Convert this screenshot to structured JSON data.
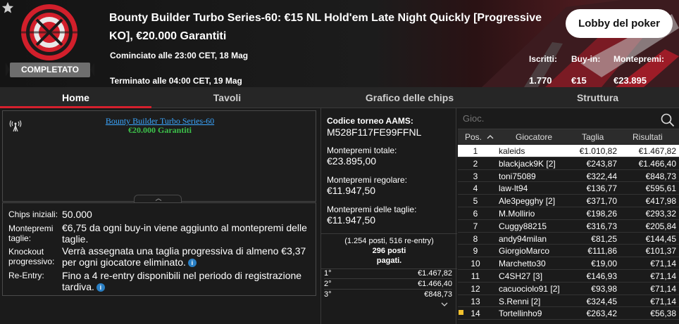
{
  "header": {
    "title": "Bounty Builder Turbo Series-60: €15 NL Hold'em Late Night Quickly [Progressive KO], €20.000 Garantiti",
    "status": "COMPLETATO",
    "started": "Cominciato alle 23:00 CET, 18 Mag",
    "ended": "Terminato alle 04:00 CET, 19 Mag",
    "lobby_button": "Lobby del poker",
    "stats": {
      "registered_label": "Iscritti:",
      "registered_value": "1.770",
      "buyin_label": "Buy-in:",
      "buyin_value": "€15",
      "prize_label": "Montepremi:",
      "prize_value": "€23.895"
    },
    "icons": [
      "star-icon",
      "tournament-badge-icon"
    ]
  },
  "tabs": [
    {
      "label": "Home",
      "active": true
    },
    {
      "label": "Tavoli",
      "active": false
    },
    {
      "label": "Grafico delle chips",
      "active": false
    },
    {
      "label": "Struttura",
      "active": false
    }
  ],
  "info": {
    "tournament_name": "Bounty Builder Turbo Series-60",
    "tournament_prize": "€20.000 Garantiti",
    "rows": [
      {
        "label": "Chips iniziali:",
        "value": "50.000"
      },
      {
        "label": "Montepremi taglie:",
        "value": "€6,75 da ogni buy-in viene aggiunto al montepremi delle taglie."
      },
      {
        "label": "Knockout progressivo:",
        "value": "Verrà assegnata una taglia progressiva di almeno €3,37 per ogni giocatore eliminato."
      },
      {
        "label": "Re-Entry:",
        "value": "Fino a 4 re-entry disponibili nel periodo di registrazione tardiva."
      }
    ]
  },
  "middle": {
    "aams_label": "Codice torneo AAMS:",
    "aams_value": "M528F117FE99FFNL",
    "total_label": "Montepremi totale:",
    "total_value": "€23.895,00",
    "regular_label": "Montepremi regolare:",
    "regular_value": "€11.947,50",
    "bounty_label": "Montepremi delle taglie:",
    "bounty_value": "€11.947,50",
    "places_line1": "(1.254 posti, 516 re-entry)",
    "places_line2": "296 posti",
    "places_line3": "pagati.",
    "payouts": [
      {
        "place": "1°",
        "amount": "€1.467,82"
      },
      {
        "place": "2°",
        "amount": "€1.466,40"
      },
      {
        "place": "3°",
        "amount": "€848,73"
      }
    ]
  },
  "players": {
    "search_placeholder": "Gioc.",
    "columns": {
      "pos": "Pos.",
      "player": "Giocatore",
      "bounty": "Taglia",
      "result": "Risultati"
    },
    "rows": [
      {
        "pos": "1",
        "name": "kaleids",
        "bounty": "€1.010,82",
        "result": "€1.467,82",
        "selected": true
      },
      {
        "pos": "2",
        "name": "blackjack9K [2]",
        "bounty": "€243,87",
        "result": "€1.466,40"
      },
      {
        "pos": "3",
        "name": "toni75089",
        "bounty": "€322,44",
        "result": "€848,73"
      },
      {
        "pos": "4",
        "name": "law-lt94",
        "bounty": "€136,77",
        "result": "€595,61"
      },
      {
        "pos": "5",
        "name": "Ale3pegghy [2]",
        "bounty": "€371,70",
        "result": "€417,98"
      },
      {
        "pos": "6",
        "name": "M.Mollirio",
        "bounty": "€198,26",
        "result": "€293,32"
      },
      {
        "pos": "7",
        "name": "Cuggy88215",
        "bounty": "€316,73",
        "result": "€205,84"
      },
      {
        "pos": "8",
        "name": "andy94milan",
        "bounty": "€81,25",
        "result": "€144,45"
      },
      {
        "pos": "9",
        "name": "GiorgioMarco",
        "bounty": "€111,86",
        "result": "€101,37"
      },
      {
        "pos": "10",
        "name": "Marchetto30",
        "bounty": "€19,00",
        "result": "€71,14"
      },
      {
        "pos": "11",
        "name": "C4SH27 [3]",
        "bounty": "€146,93",
        "result": "€71,14"
      },
      {
        "pos": "12",
        "name": "cacuociolo91 [2]",
        "bounty": "€93,98",
        "result": "€71,14"
      },
      {
        "pos": "13",
        "name": "S.Renni [2]",
        "bounty": "€324,45",
        "result": "€71,14"
      },
      {
        "pos": "14",
        "name": "Tortellinho9",
        "bounty": "€263,42",
        "result": "€56,38",
        "marked": true
      }
    ]
  }
}
